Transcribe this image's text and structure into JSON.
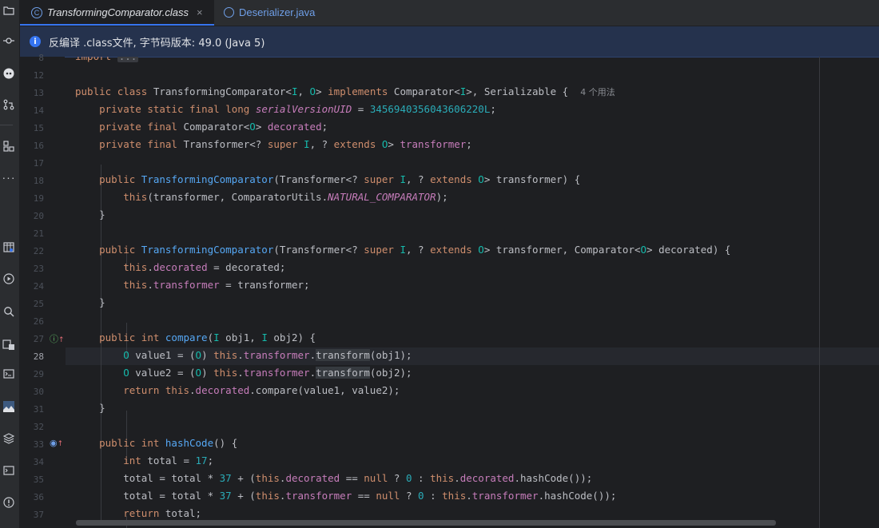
{
  "tabs": [
    {
      "label": "TransformingComparator.class",
      "active": true,
      "icon": "class-file-icon",
      "close": "×"
    },
    {
      "label": "Deserializer.java",
      "active": false,
      "icon": "java-file-icon"
    }
  ],
  "banner": {
    "icon": "info-icon",
    "text": "反编译 .class文件, 字节码版本: 49.0 (Java 5)"
  },
  "sidebar_icons": [
    "folder-icon",
    "commit-icon",
    "copilot-icon",
    "pull-request-icon",
    "structure-icon",
    "more-icon",
    "bookmarks-icon",
    "run-icon",
    "find-icon",
    "services-icon",
    "terminal-icon",
    "image-icon",
    "layers-icon",
    "console-icon",
    "problems-icon"
  ],
  "editor": {
    "current_line": "28",
    "lines": [
      {
        "n": "8",
        "t": "import ..."
      },
      {
        "n": "12",
        "t": ""
      },
      {
        "n": "13",
        "t": "public class TransformingComparator<I, O> implements Comparator<I>, Serializable {",
        "hint": "4 个用法"
      },
      {
        "n": "14",
        "t": "    private static final long serialVersionUID = 3456940356043606220L;"
      },
      {
        "n": "15",
        "t": "    private final Comparator<O> decorated;"
      },
      {
        "n": "16",
        "t": "    private final Transformer<? super I, ? extends O> transformer;"
      },
      {
        "n": "17",
        "t": ""
      },
      {
        "n": "18",
        "t": "    public TransformingComparator(Transformer<? super I, ? extends O> transformer) {"
      },
      {
        "n": "19",
        "t": "        this(transformer, ComparatorUtils.NATURAL_COMPARATOR);"
      },
      {
        "n": "20",
        "t": "    }"
      },
      {
        "n": "21",
        "t": ""
      },
      {
        "n": "22",
        "t": "    public TransformingComparator(Transformer<? super I, ? extends O> transformer, Comparator<O> decorated) {"
      },
      {
        "n": "23",
        "t": "        this.decorated = decorated;"
      },
      {
        "n": "24",
        "t": "        this.transformer = transformer;"
      },
      {
        "n": "25",
        "t": "    }"
      },
      {
        "n": "26",
        "t": ""
      },
      {
        "n": "27",
        "t": "    public int compare(I obj1, I obj2) {"
      },
      {
        "n": "28",
        "t": "        O value1 = (O) this.transformer.transform(obj1);"
      },
      {
        "n": "29",
        "t": "        O value2 = (O) this.transformer.transform(obj2);"
      },
      {
        "n": "30",
        "t": "        return this.decorated.compare(value1, value2);"
      },
      {
        "n": "31",
        "t": "    }"
      },
      {
        "n": "32",
        "t": ""
      },
      {
        "n": "33",
        "t": "    public int hashCode() {"
      },
      {
        "n": "34",
        "t": "        int total = 17;"
      },
      {
        "n": "35",
        "t": "        total = total * 37 + (this.decorated == null ? 0 : this.decorated.hashCode());"
      },
      {
        "n": "36",
        "t": "        total = total * 37 + (this.transformer == null ? 0 : this.transformer.hashCode());"
      },
      {
        "n": "37",
        "t": "        return total;"
      }
    ]
  }
}
